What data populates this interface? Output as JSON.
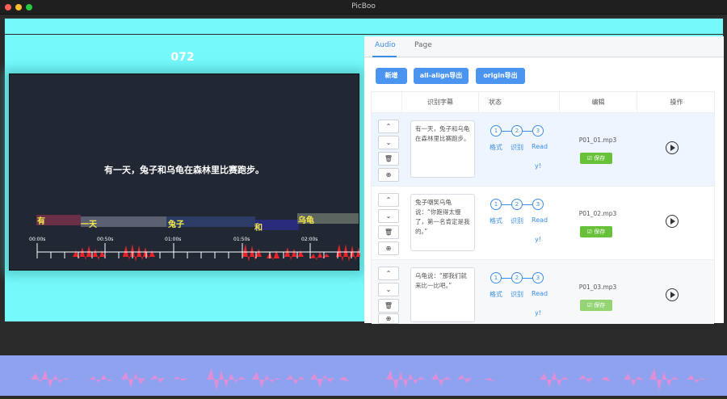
{
  "window": {
    "title": "PicBoo"
  },
  "preview": {
    "frame_number": "072",
    "subtitle": "有一天，兔子和乌龟在森林里比赛跑步。",
    "segments": [
      {
        "label": "有",
        "color": "#6b3047"
      },
      {
        "label": "一天",
        "color": "#5a5f72"
      },
      {
        "label": "兔子",
        "color": "#2c3c66"
      },
      {
        "label": "和",
        "color": "#2a2a7a"
      },
      {
        "label": "乌龟",
        "color": "#5d6561"
      }
    ],
    "timeline_ticks": [
      "00:00s",
      "00:50s",
      "01:00s",
      "01:50s",
      "02:00s"
    ]
  },
  "panel": {
    "tabs": [
      {
        "label": "Audio",
        "active": true
      },
      {
        "label": "Page",
        "active": false
      }
    ],
    "buttons": {
      "add": "新增",
      "all_align_export": "all-align导出",
      "origin_export": "origin导出"
    },
    "columns": [
      "识别字幕",
      "状态",
      "编辑",
      "操作"
    ],
    "status_steps": [
      "1",
      "2",
      "3"
    ],
    "status_labels": [
      "格式",
      "识别",
      "Read",
      "y!"
    ],
    "save_label": "保存",
    "rows": [
      {
        "text": "有一天，兔子和乌龟在森林里比赛跑步。",
        "file": "P01_01.mp3"
      },
      {
        "text": "兔子嘲笑乌龟说：“你跑得太慢了，第一名肯定是我的。”",
        "file": "P01_02.mp3"
      },
      {
        "text": "乌龟说：“那我们就来比一比吧。”",
        "file": "P01_03.mp3"
      }
    ]
  }
}
